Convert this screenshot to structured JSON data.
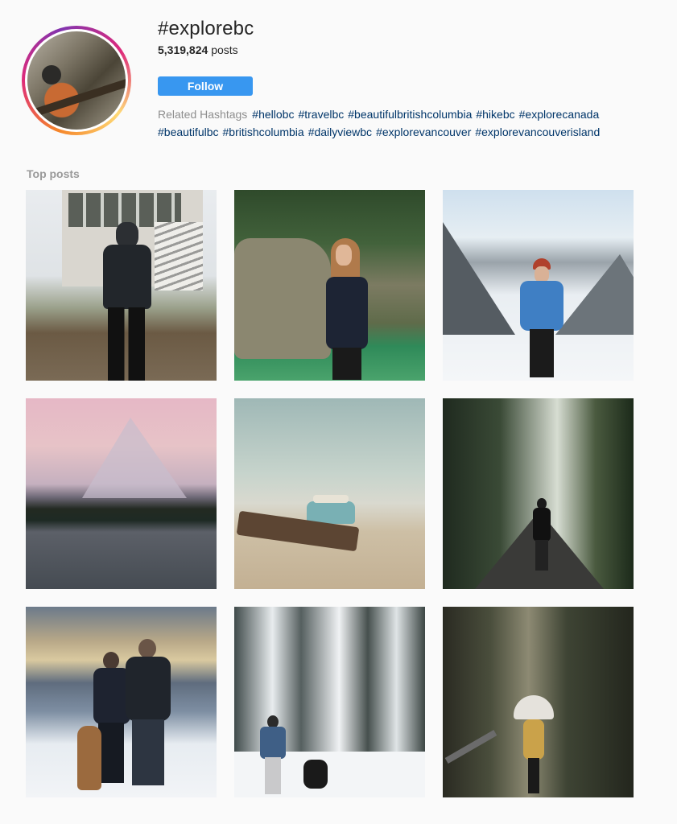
{
  "header": {
    "hashtag_title": "#explorebc",
    "post_count_value": "5,319,824",
    "post_count_suffix": "posts",
    "follow_label": "Follow"
  },
  "related": {
    "label": "Related Hashtags",
    "tags": [
      "#hellobc",
      "#travelbc",
      "#beautifulbritishcolumbia",
      "#hikebc",
      "#explorecanada",
      "#beautifulbc",
      "#britishcolumbia",
      "#dailyviewbc",
      "#explorevancouver",
      "#explorevancouverisland"
    ]
  },
  "sections": {
    "top_posts_label": "Top posts"
  },
  "colors": {
    "follow_button": "#3897f0",
    "hashtag_link": "#003569",
    "muted_text": "#8e8e8e",
    "background": "#fafafa"
  }
}
